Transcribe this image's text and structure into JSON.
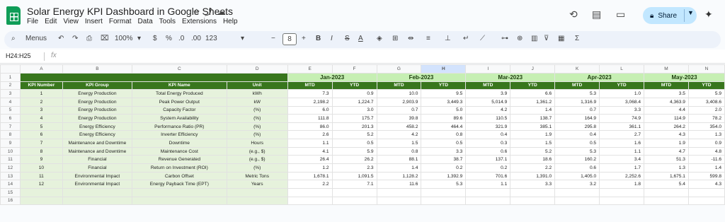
{
  "app": {
    "title": "Solar Energy KPI Dashboard in Google Sheets",
    "menu": [
      "File",
      "Edit",
      "View",
      "Insert",
      "Format",
      "Data",
      "Tools",
      "Extensions",
      "Help"
    ],
    "share_label": "Share"
  },
  "toolbar": {
    "menus_label": "Menus",
    "zoom": "100%",
    "currency": "$",
    "percent": "%",
    "dec_decrease": ".0",
    "dec_increase": ".00",
    "number_format": "123",
    "font_size": "8",
    "minus": "−",
    "plus": "+",
    "bold": "B",
    "italic": "I",
    "strike": "S",
    "text_color": "A",
    "sigma": "Σ"
  },
  "formula_bar": {
    "name_box": "H24:H25",
    "fx": "fx"
  },
  "sheet": {
    "columns": [
      "A",
      "B",
      "C",
      "D",
      "E",
      "F",
      "G",
      "H",
      "I",
      "J",
      "K",
      "L",
      "M",
      "N"
    ],
    "selected_column": "H",
    "row_numbers": [
      "1",
      "2",
      "3",
      "4",
      "5",
      "6",
      "7",
      "8",
      "9",
      "10",
      "11",
      "12",
      "13",
      "14",
      "15",
      "16"
    ],
    "months": [
      "Jan-2023",
      "Feb-2023",
      "Mar-2023",
      "Apr-2023",
      "May-2023"
    ],
    "headers": [
      "KPI Number",
      "KPI Group",
      "KPI Name",
      "Unit",
      "MTD",
      "YTD",
      "MTD",
      "YTD",
      "MTD",
      "YTD",
      "MTD",
      "YTD",
      "MTD",
      "YTD"
    ],
    "rows": [
      [
        "1",
        "Energy Production",
        "Total Energy Produced",
        "kWh",
        "7.3",
        "0.9",
        "10.0",
        "9.5",
        "3.9",
        "6.6",
        "5.3",
        "1.0",
        "3.5",
        "5.9"
      ],
      [
        "2",
        "Energy Production",
        "Peak Power Output",
        "kW",
        "2,198.2",
        "1,224.7",
        "2,903.9",
        "3,449.3",
        "5,014.9",
        "1,361.2",
        "1,316.9",
        "3,068.4",
        "4,363.9",
        "3,408.6"
      ],
      [
        "3",
        "Energy Production",
        "Capacity Factor",
        "(%)",
        "6.0",
        "3.0",
        "0.7",
        "5.0",
        "4.2",
        "1.4",
        "0.7",
        "3.3",
        "4.4",
        "2.0"
      ],
      [
        "4",
        "Energy Production",
        "System Availability",
        "(%)",
        "111.8",
        "175.7",
        "39.8",
        "89.6",
        "110.5",
        "138.7",
        "164.9",
        "74.9",
        "114.9",
        "78.2"
      ],
      [
        "5",
        "Energy Efficiency",
        "Performance Ratio (PR)",
        "(%)",
        "86.0",
        "201.3",
        "458.2",
        "464.4",
        "321.9",
        "385.1",
        "295.8",
        "361.1",
        "264.2",
        "354.0"
      ],
      [
        "6",
        "Energy Efficiency",
        "Inverter Efficiency",
        "(%)",
        "2.6",
        "5.2",
        "4.2",
        "0.8",
        "0.4",
        "1.9",
        "0.4",
        "2.7",
        "4.3",
        "1.3"
      ],
      [
        "7",
        "Maintenance and Downtime",
        "Downtime",
        "Hours",
        "1.1",
        "0.5",
        "1.5",
        "0.5",
        "0.3",
        "1.5",
        "0.5",
        "1.6",
        "1.9",
        "0.9"
      ],
      [
        "8",
        "Maintenance and Downtime",
        "Maintenance Cost",
        "(e.g., $)",
        "4.1",
        "5.9",
        "0.8",
        "3.3",
        "0.6",
        "5.2",
        "5.3",
        "1.1",
        "4.7",
        "4.8"
      ],
      [
        "9",
        "Financial",
        "Revenue Generated",
        "(e.g., $)",
        "26.4",
        "26.2",
        "88.1",
        "38.7",
        "137.1",
        "18.6",
        "160.2",
        "3.4",
        "51.3",
        "-11.6"
      ],
      [
        "10",
        "Financial",
        "Return on Investment (ROI)",
        "(%)",
        "1.2",
        "2.3",
        "1.4",
        "0.2",
        "0.2",
        "2.2",
        "0.6",
        "1.7",
        "1.3",
        "1.4"
      ],
      [
        "11",
        "Environmental Impact",
        "Carbon Offset",
        "Metric Tons",
        "1,678.1",
        "1,091.5",
        "1,128.2",
        "1,392.9",
        "701.6",
        "1,391.0",
        "1,405.0",
        "2,252.6",
        "1,675.1",
        "599.8"
      ],
      [
        "12",
        "Environmental Impact",
        "Energy Payback Time (EPT)",
        "Years",
        "2.2",
        "7.1",
        "11.6",
        "5.3",
        "1.1",
        "3.3",
        "3.2",
        "1.8",
        "5.4",
        "4.3"
      ]
    ]
  },
  "icons": {
    "star": "star-icon",
    "move": "move-icon",
    "cloud": "cloud-status-icon",
    "history": "history-icon",
    "comment": "comment-icon",
    "meet": "video-icon",
    "lock": "lock-icon",
    "gemini": "gemini-icon"
  },
  "colors": {
    "header_green": "#38761d",
    "month_green": "#c6efb3",
    "meta_green": "#e6f2dc",
    "share_blue": "#c2e7ff"
  }
}
